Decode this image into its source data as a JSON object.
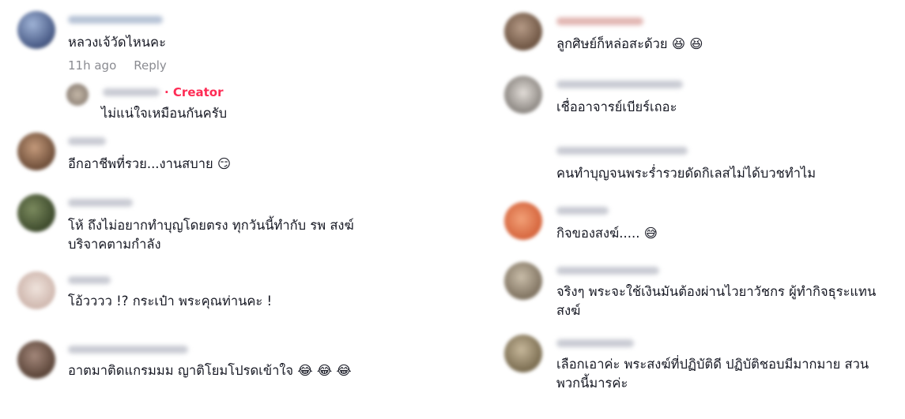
{
  "left": {
    "comments": [
      {
        "text": "หลวงเจ้วัดไหนคะ",
        "meta": {
          "time": "11h ago",
          "reply": "Reply"
        }
      },
      {
        "text": "ไม่แน่ใจเหมือนกันครับ",
        "creator_label": "· Creator"
      },
      {
        "text": "อีกอาชีพที่รวย...งานสบาย 😏"
      },
      {
        "text_line1": "โห้ ถึงไม่อยากทำบุญโดยตรง ทุกวันนี้ทำกับ รพ สงฆ์",
        "text_line2": "บริจาคตามกำลัง"
      },
      {
        "text": "โอ้วววว !? กระเป๋า พระคุณท่านคะ !"
      },
      {
        "text": "อาตมาติดแกรมมม ญาติโยมโปรดเข้าใจ 😂 😂 😂"
      }
    ]
  },
  "right": {
    "comments": [
      {
        "text": "ลูกศิษย์ก็หล่อสะด้วย 😆 😆"
      },
      {
        "text": "เชื่ออาจารย์เบียร์เถอะ"
      },
      {
        "text": "คนทำบุญจนพระร่ำรวยดัดกิเลสไม่ได้บวชทำไม"
      },
      {
        "text": "กิจของสงฆ์..... 😅"
      },
      {
        "text_line1": "จริงๆ พระจะใช้เงินมันต้องผ่านไวยาวัชกร ผู้ทำกิจธุระแทน",
        "text_line2": "สงฆ์"
      },
      {
        "text_line1": "เลือกเอาค่ะ พระสงฆ์ที่ปฏิบัติดี ปฏิบัติชอบมีมากมาย สวน",
        "text_line2": "พวกนี้มารค่ะ"
      }
    ]
  },
  "colors": {
    "creator": "#fe2c55",
    "meta": "#8a8b91",
    "text": "#161823"
  }
}
